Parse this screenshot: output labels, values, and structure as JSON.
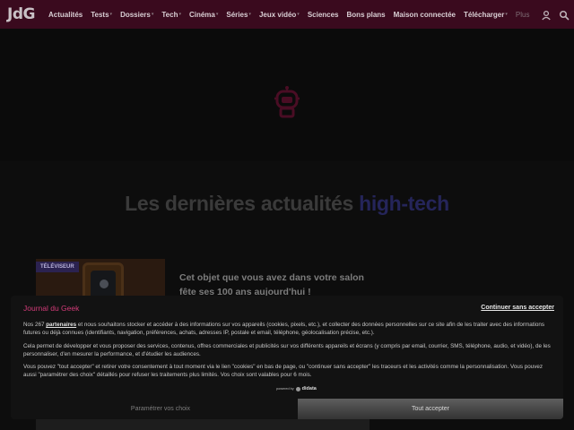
{
  "header": {
    "logo": "JdG",
    "nav": [
      {
        "label": "Actualités",
        "has_caret": false
      },
      {
        "label": "Tests",
        "has_caret": true
      },
      {
        "label": "Dossiers",
        "has_caret": true
      },
      {
        "label": "Tech",
        "has_caret": true
      },
      {
        "label": "Cinéma",
        "has_caret": true
      },
      {
        "label": "Séries",
        "has_caret": true
      },
      {
        "label": "Jeux vidéo",
        "has_caret": true
      },
      {
        "label": "Sciences",
        "has_caret": false
      },
      {
        "label": "Bons plans",
        "has_caret": false
      },
      {
        "label": "Maison connectée",
        "has_caret": false
      },
      {
        "label": "Télécharger",
        "has_caret": true
      }
    ],
    "more_label": "Plus",
    "icons": [
      "user-icon",
      "search-icon"
    ]
  },
  "main": {
    "section_title_prefix": "Les dernières actualités ",
    "section_title_highlight": "high-tech",
    "article": {
      "tag": "TÉLÉVISEUR",
      "title": "Cet objet que vous avez dans votre salon fête ses 100 ans aujourd'hui !"
    }
  },
  "consent": {
    "brand": "Journal du Geek",
    "continue_label": "Continuer sans accepter",
    "p1_a": "Nos 267 ",
    "p1_link": "partenaires",
    "p1_b": " et nous souhaitons stocker et accéder à des informations sur vos appareils (cookies, pixels, etc.), et collecter des données personnelles sur ce site afin de les traiter avec des informations futures ou déjà connues (identifiants, navigation, préférences, achats, adresses IP, postale et email, téléphone, géolocalisation précise, etc.).",
    "p2": "Cela permet de développer et vous proposer des services, contenus, offres commerciales et publicités sur vos différents appareils et écrans (y compris par email, courrier, SMS, téléphone, audio, et vidéo), de les personnaliser, d'en mesurer la performance, et d'étudier les audiences.",
    "p3": "Vous pouvez \"tout accepter\" et retirer votre consentement à tout moment via le lien \"cookies\" en bas de page, ou \"continuer sans accepter\" les traceurs et les activités comme la personnalisation. Vous pouvez aussi \"paramétrer des choix\" détaillés pour refuser les traitements plus limités. Vos choix sont valables pour 6 mois.",
    "powered_by": "powered by",
    "powered_brand": "didata",
    "params_label": "Paramétrer vos choix",
    "accept_label": "Tout accepter"
  },
  "colors": {
    "topbar": "#3a0a1e",
    "brand_pink": "#d23b78",
    "highlight_blue": "#25255a",
    "tag_bg": "#2b2250"
  }
}
